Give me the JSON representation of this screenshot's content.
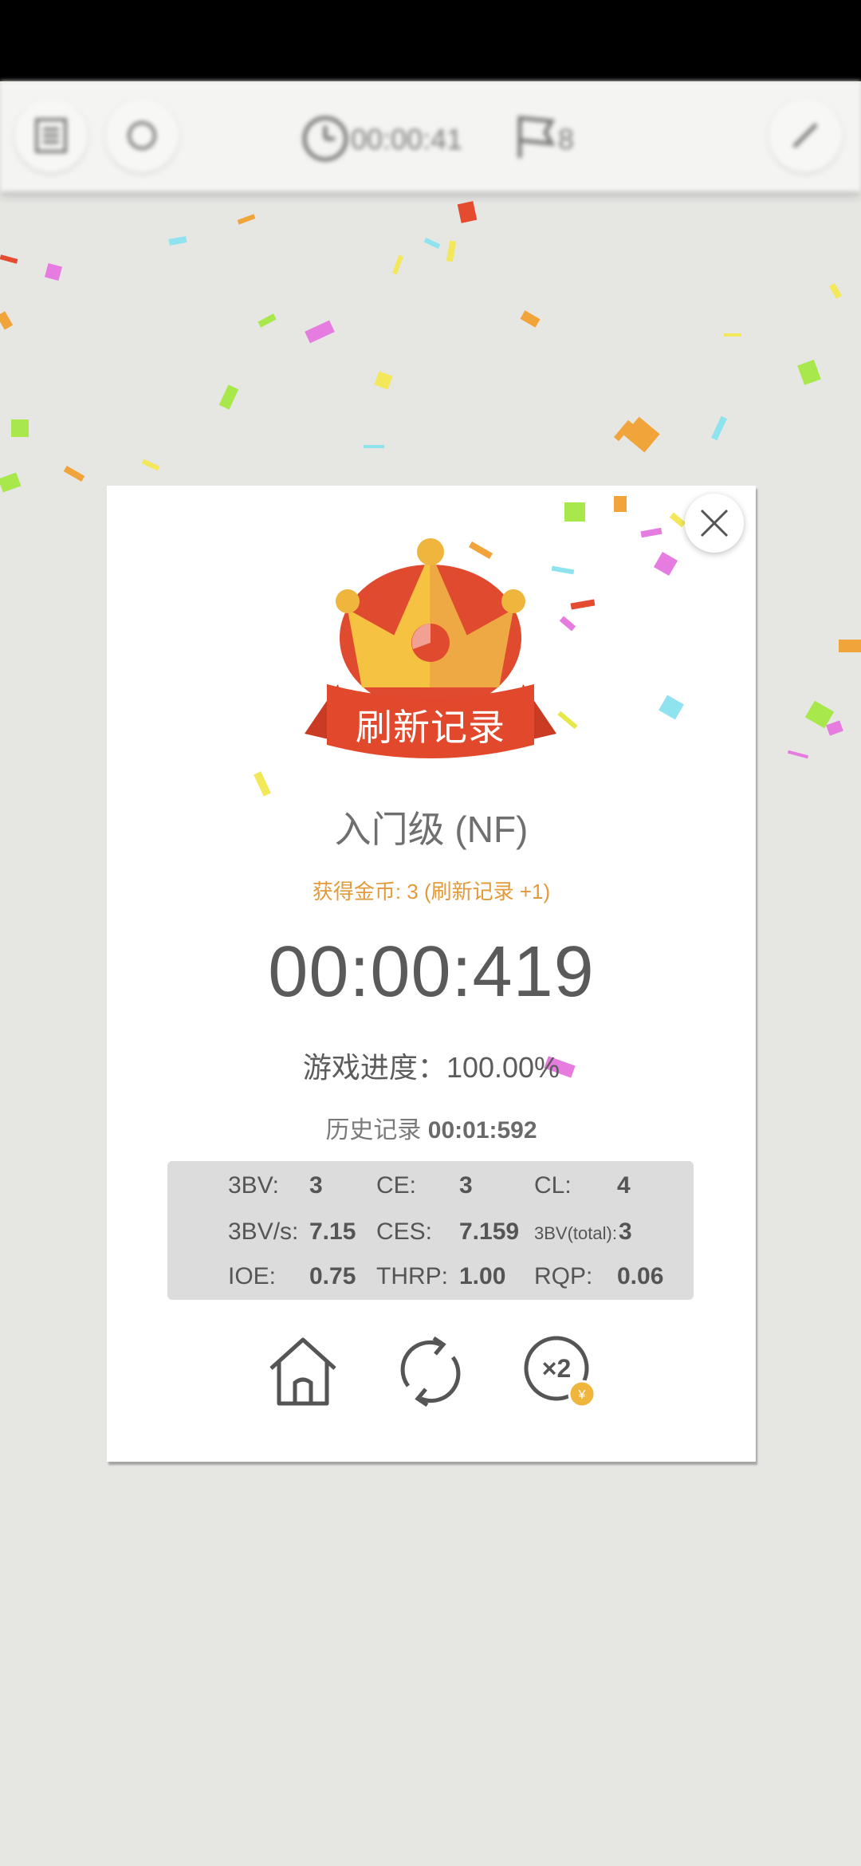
{
  "toolbar": {
    "timer": "00:00:41",
    "flags": "8"
  },
  "dialog": {
    "banner": "刷新记录",
    "level": "入门级 (NF)",
    "coins": "获得金币: 3 (刷新记录 +1)",
    "time": "00:00:419",
    "progress_label": "游戏进度：",
    "progress_value": "100.00%",
    "history_label": "历史记录",
    "history_value": "00:01:592"
  },
  "stats": [
    {
      "label": "3BV:",
      "value": "3"
    },
    {
      "label": "CE:",
      "value": "3"
    },
    {
      "label": "CL:",
      "value": "4"
    },
    {
      "label": "3BV/s:",
      "value": "7.15"
    },
    {
      "label": "CES:",
      "value": "7.159"
    },
    {
      "label": "3BV(total):",
      "value": "3"
    },
    {
      "label": "IOE:",
      "value": "0.75"
    },
    {
      "label": "THRP:",
      "value": "1.00"
    },
    {
      "label": "RQP:",
      "value": "0.06"
    }
  ],
  "actions": {
    "home_icon": "home-icon",
    "restart_icon": "restart-icon",
    "double_icon": "double-reward-icon",
    "double_label": "×2",
    "coin_symbol": "¥"
  },
  "colors": {
    "crown_gold": "#f5c242",
    "crown_orange": "#eea844",
    "crown_red": "#e04a2f",
    "ribbon": "#e2492c",
    "coins_text": "#e29a3a"
  }
}
